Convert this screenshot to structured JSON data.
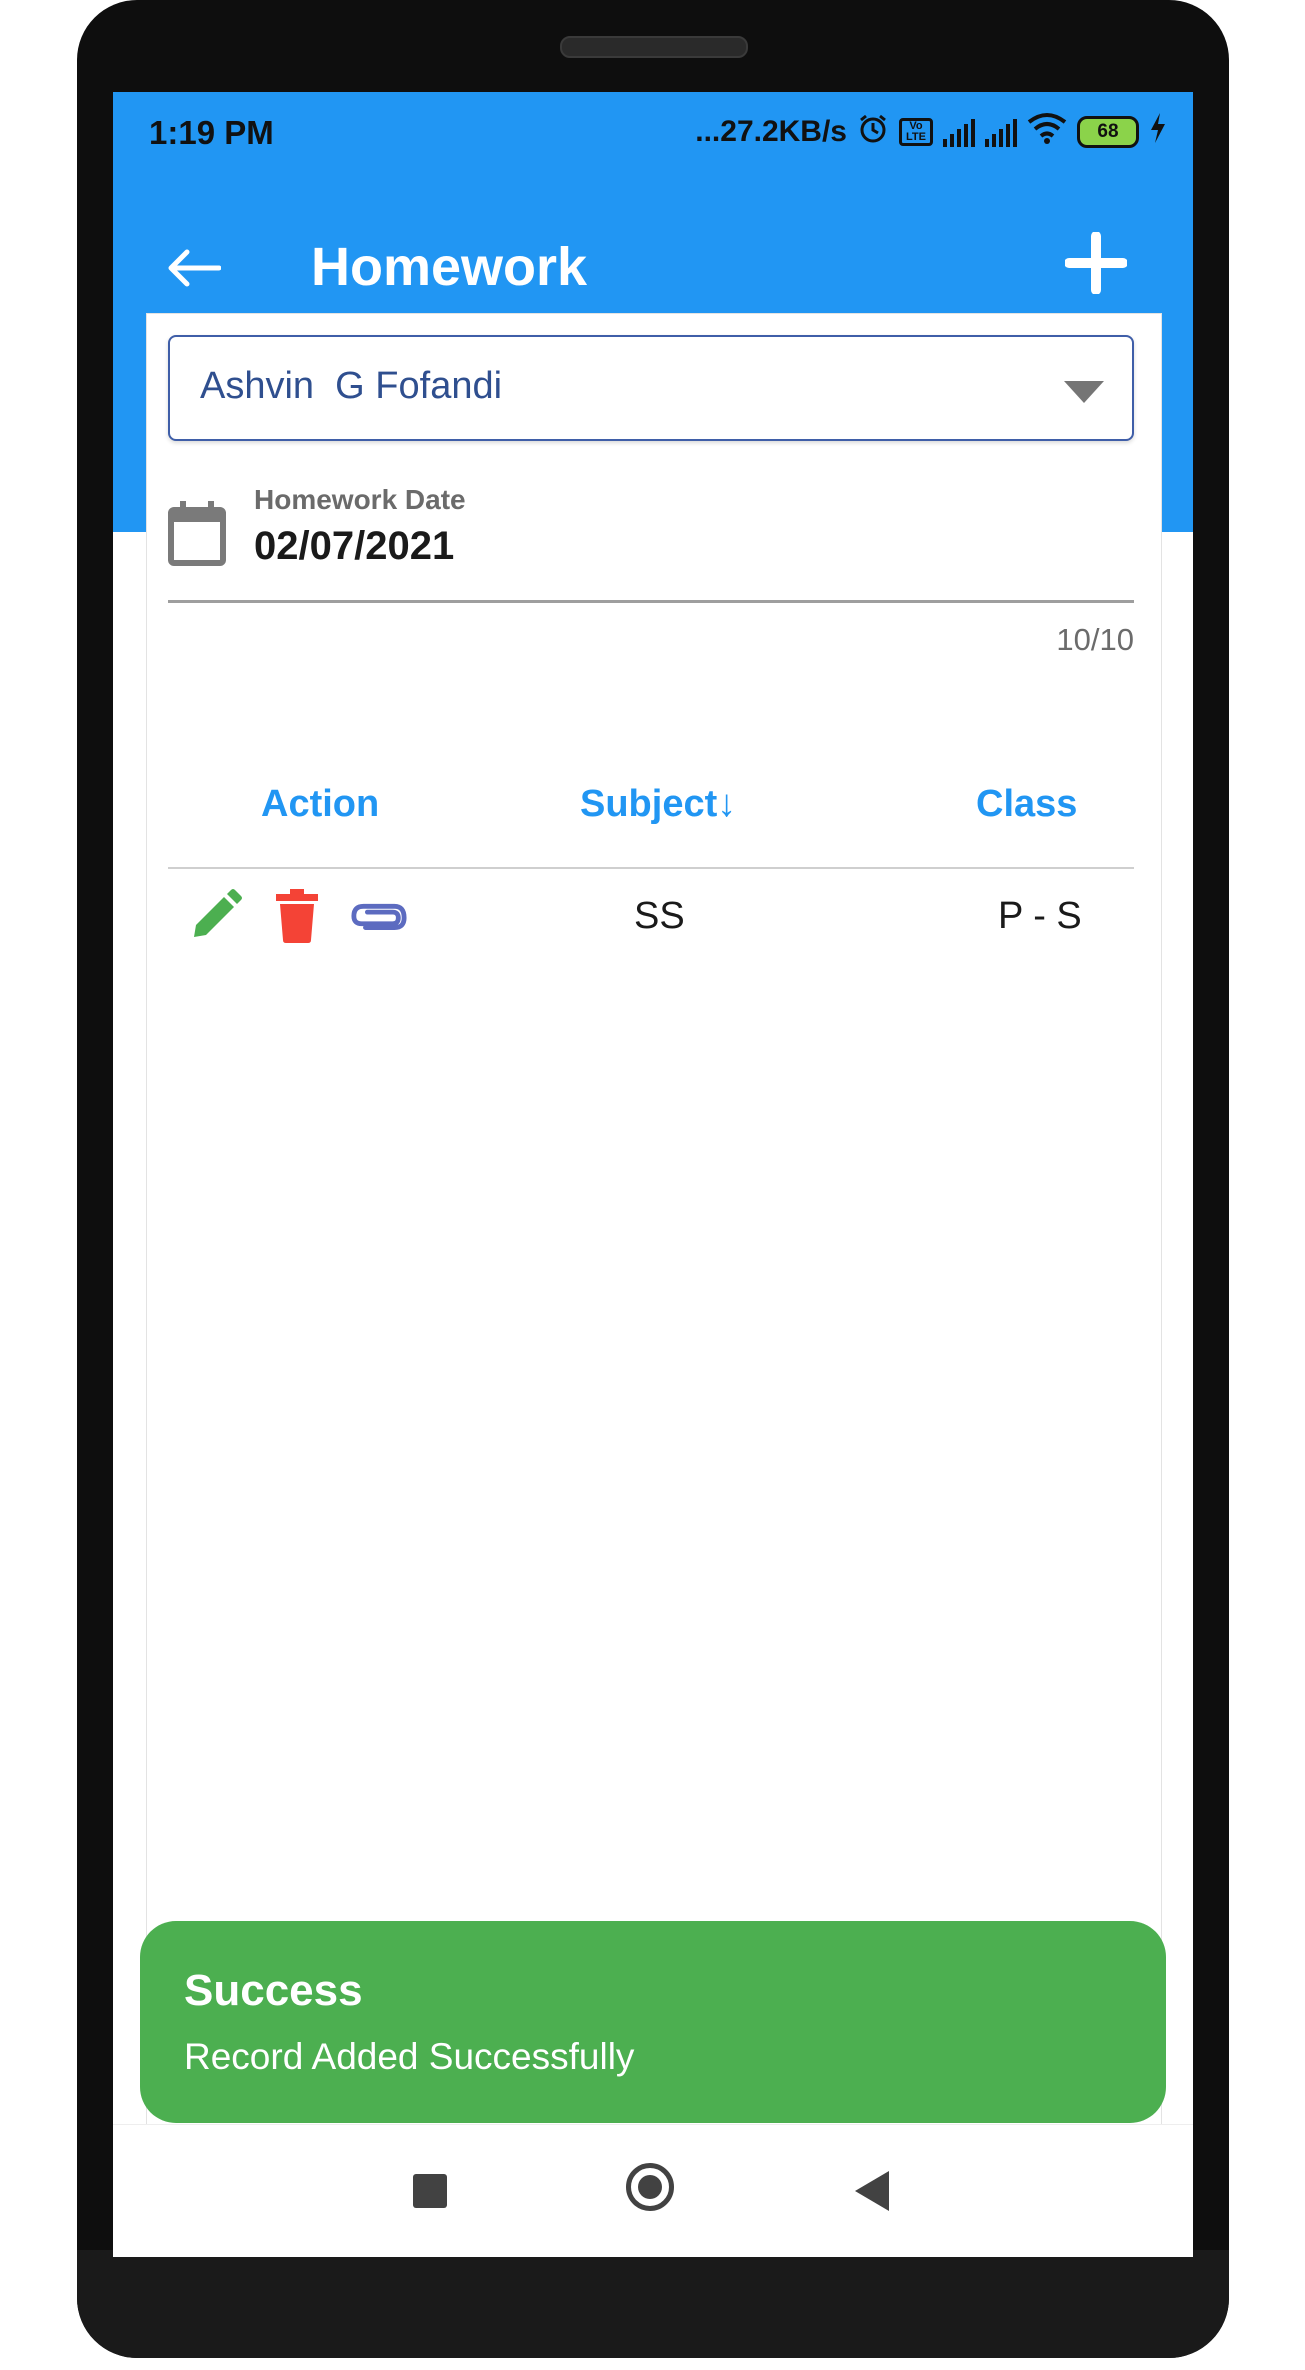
{
  "status_bar": {
    "time": "1:19 PM",
    "network_speed": "...27.2KB/s",
    "volte_label": "Vo LTE",
    "battery_level": "68"
  },
  "header": {
    "title": "Homework",
    "back_icon": "arrow-left-icon",
    "add_icon": "plus-icon"
  },
  "student_select": {
    "selected": "Ashvin  G Fofandi"
  },
  "date_field": {
    "label": "Homework Date",
    "value": "02/07/2021"
  },
  "count_text": "10/10",
  "table": {
    "columns": [
      "Action",
      "Subject↓",
      "Class"
    ],
    "rows": [
      {
        "subject": "SS",
        "class": "P - S",
        "actions": [
          "pencil-icon",
          "trash-icon",
          "paperclip-icon"
        ]
      }
    ]
  },
  "toast": {
    "title": "Success",
    "message": "Record Added Successfully"
  },
  "nav_bar": {
    "icons": [
      "recent-apps-icon",
      "home-icon",
      "back-triangle-icon"
    ]
  },
  "colors": {
    "primary": "#2196f3",
    "success": "#4caf50",
    "edit": "#4caf50",
    "delete": "#f44336",
    "attach": "#5c6bc0"
  }
}
